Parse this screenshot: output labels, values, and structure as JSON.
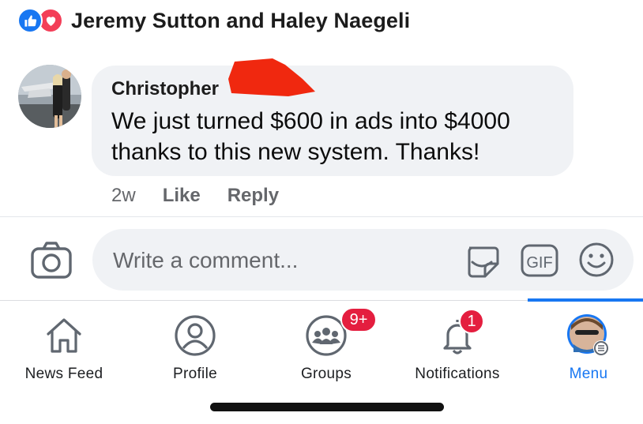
{
  "post": {
    "reactions": {
      "types": [
        "like-icon",
        "love-icon"
      ],
      "reactors": "Jeremy Sutton and Haley Naegeli"
    }
  },
  "comment": {
    "author": "Christopher",
    "text": "We just turned $600 in ads into $4000 thanks to this new system. Thanks!",
    "time": "2w",
    "like_label": "Like",
    "reply_label": "Reply"
  },
  "composer": {
    "placeholder": "Write a comment...",
    "icons": [
      "camera-icon",
      "sticker-icon",
      "gif-icon",
      "emoji-icon"
    ],
    "gif_label": "GIF"
  },
  "nav": {
    "items": [
      {
        "label": "News Feed",
        "icon": "home-icon"
      },
      {
        "label": "Profile",
        "icon": "profile-icon"
      },
      {
        "label": "Groups",
        "icon": "groups-icon",
        "badge": "9+"
      },
      {
        "label": "Notifications",
        "icon": "bell-icon",
        "badge": "1"
      },
      {
        "label": "Menu",
        "icon": "menu-avatar",
        "active": true
      }
    ]
  },
  "colors": {
    "brand_blue": "#1877f2",
    "badge_red": "#e41e3f",
    "love_red": "#f33e58",
    "bubble_gray": "#f0f2f5",
    "secondary_text": "#65676b",
    "redaction_red": "#f0280f"
  }
}
